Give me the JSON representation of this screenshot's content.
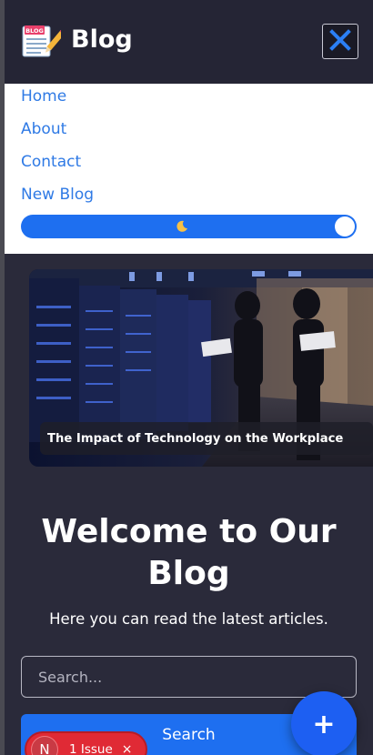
{
  "header": {
    "logo_text": "Blog",
    "logo_icon": "blog-notepad-icon",
    "logo_badge": "BLOG",
    "close_icon": "close-x-icon"
  },
  "menu": {
    "items": [
      {
        "label": "Home"
      },
      {
        "label": "About"
      },
      {
        "label": "Contact"
      },
      {
        "label": "New Blog"
      }
    ],
    "theme_toggle": {
      "state": "dark",
      "icon": "moon-icon"
    }
  },
  "featured": {
    "caption": "The Impact of Technology on the Workplace"
  },
  "welcome": {
    "title_line1": "Welcome to Our",
    "title_line2": "Blog",
    "subtitle": "Here you can read the latest articles."
  },
  "search": {
    "placeholder": "Search...",
    "value": "",
    "button_label": "Search"
  },
  "fab": {
    "label": "+"
  },
  "issues_badge": {
    "avatar_letter": "N",
    "text": "1 Issue",
    "close": "×"
  },
  "colors": {
    "background": "#2a2a3a",
    "accent": "#1e6ff0",
    "link": "#2f7ae5",
    "issue": "#e02a35"
  }
}
